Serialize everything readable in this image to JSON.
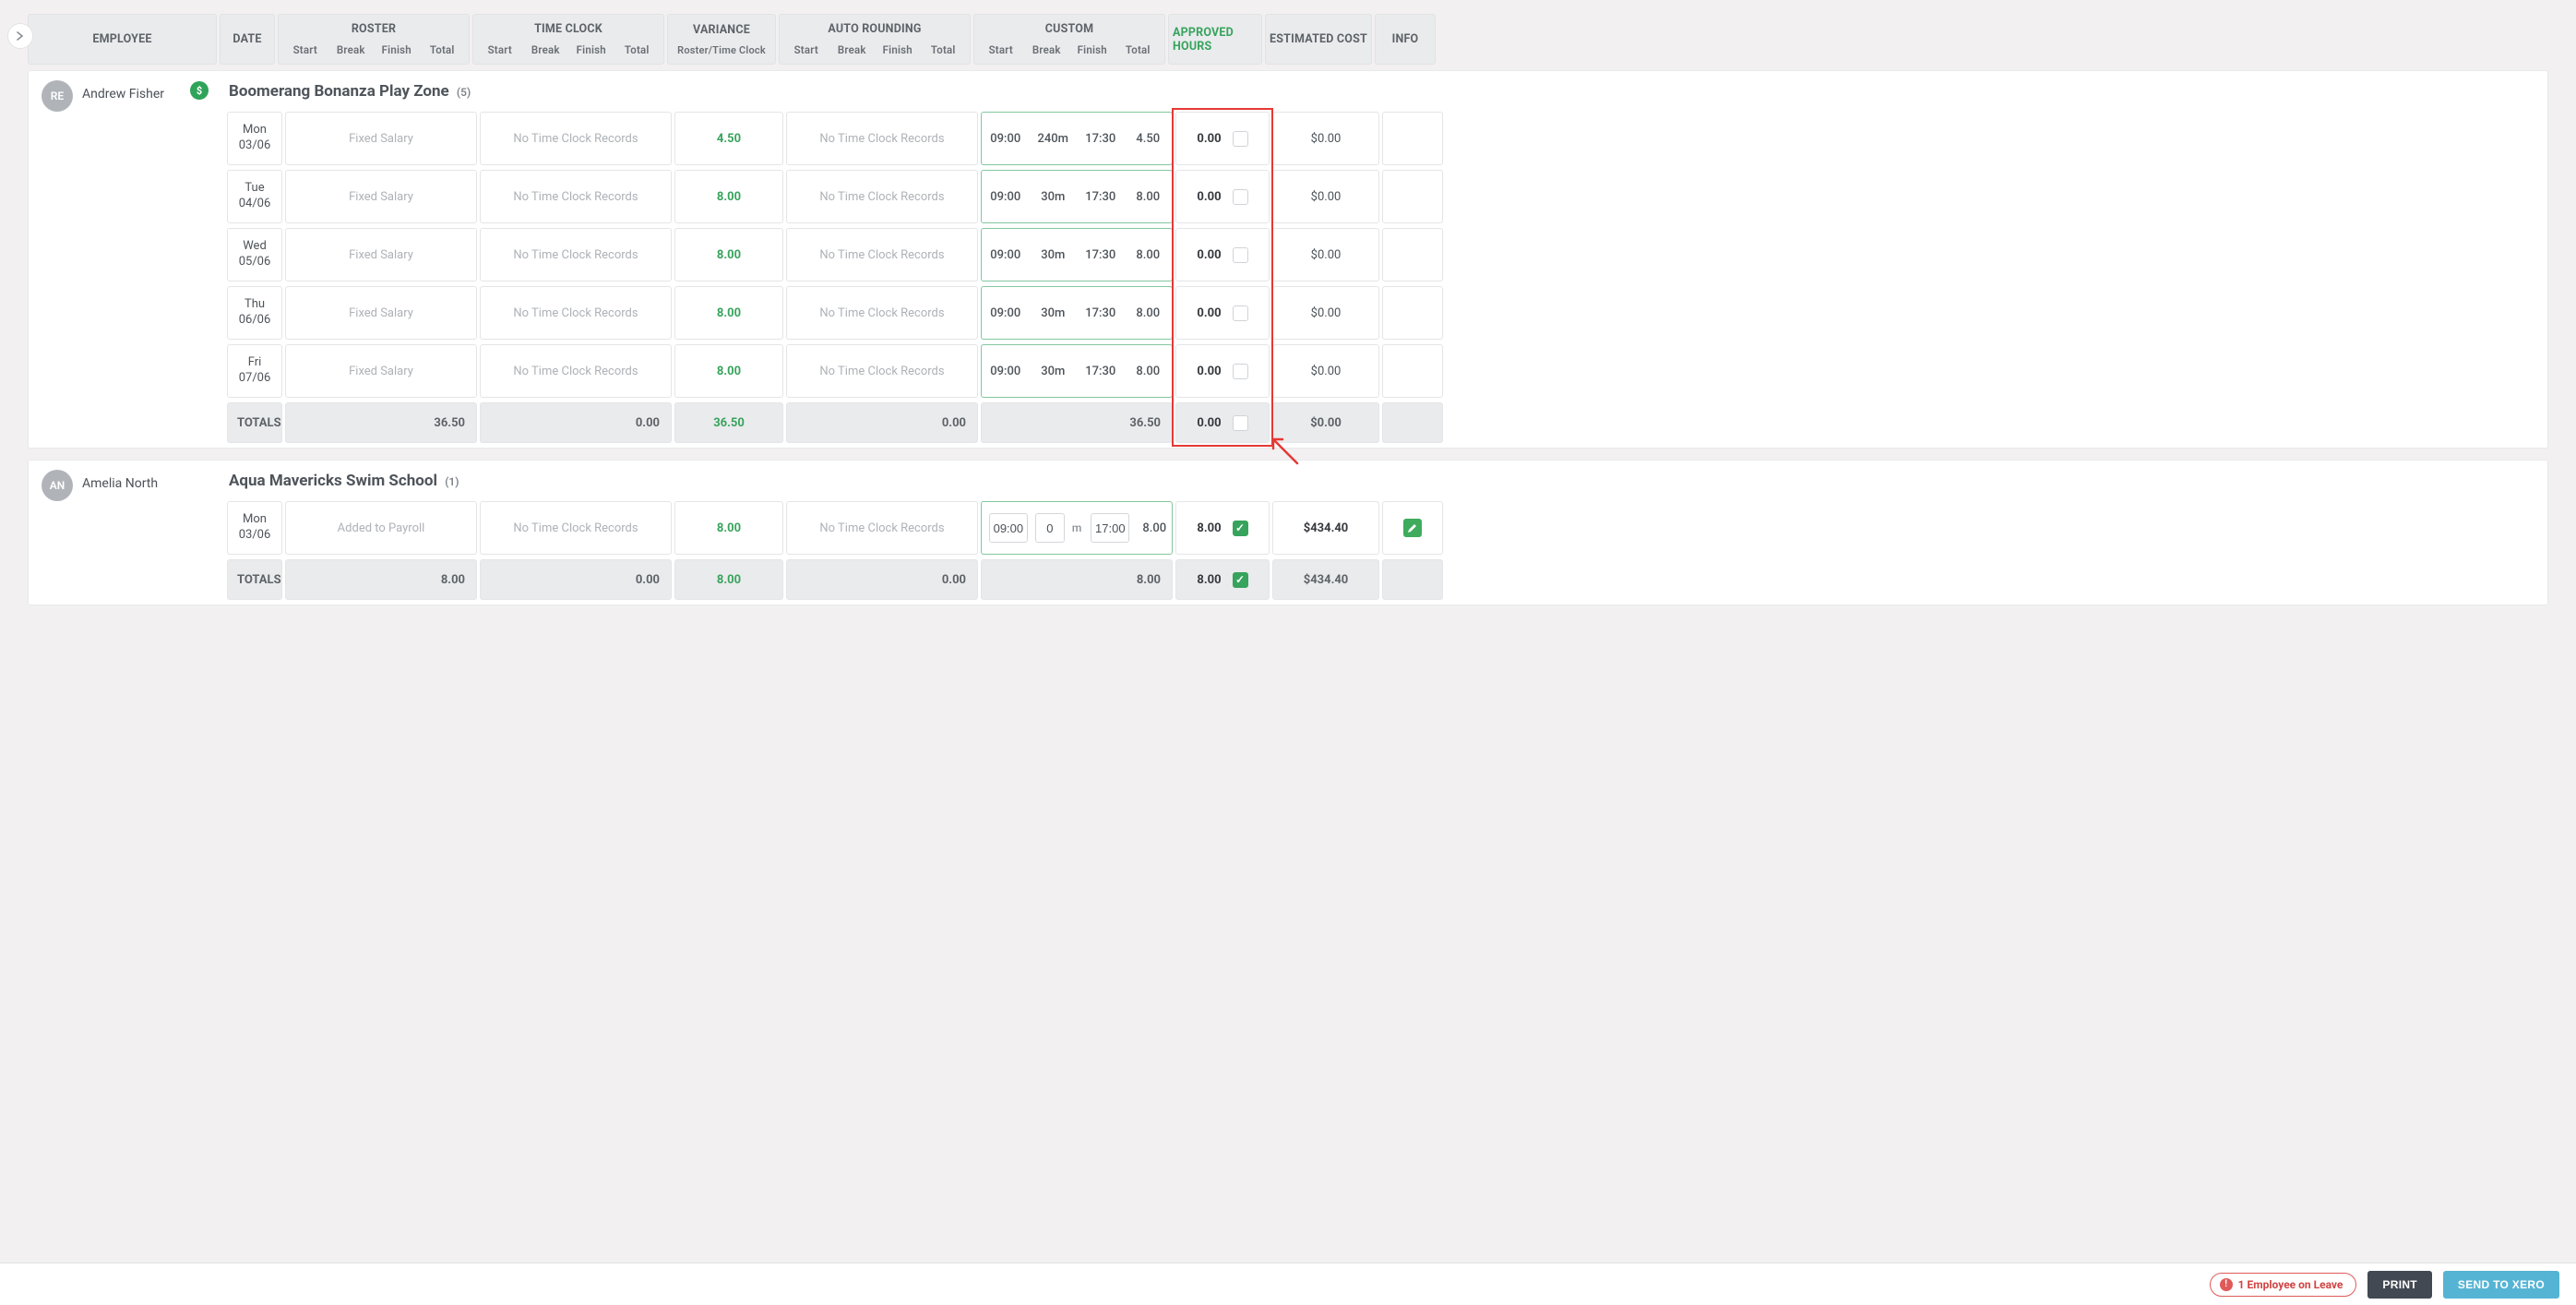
{
  "header": {
    "employee": "EMPLOYEE",
    "date": "DATE",
    "roster": "ROSTER",
    "timeclock": "TIME CLOCK",
    "variance": "VARIANCE",
    "variance_sub": "Roster/Time Clock",
    "autorounding": "AUTO ROUNDING",
    "custom": "CUSTOM",
    "approved": "APPROVED HOURS",
    "cost": "ESTIMATED COST",
    "info": "INFO",
    "subs": {
      "start": "Start",
      "break": "Break",
      "finish": "Finish",
      "total": "Total"
    }
  },
  "employees": [
    {
      "initials": "RE",
      "name": "Andrew Fisher",
      "has_dollar": true,
      "location": "Boomerang Bonanza Play Zone",
      "count": "(5)",
      "rows": [
        {
          "day": "Mon",
          "date": "03/06",
          "roster": "Fixed Salary",
          "tc": "No Time Clock Records",
          "variance": "4.50",
          "auto": "No Time Clock Records",
          "c_start": "09:00",
          "c_break": "240m",
          "c_finish": "17:30",
          "c_total": "4.50",
          "approved": "0.00",
          "checked": false,
          "cost": "$0.00"
        },
        {
          "day": "Tue",
          "date": "04/06",
          "roster": "Fixed Salary",
          "tc": "No Time Clock Records",
          "variance": "8.00",
          "auto": "No Time Clock Records",
          "c_start": "09:00",
          "c_break": "30m",
          "c_finish": "17:30",
          "c_total": "8.00",
          "approved": "0.00",
          "checked": false,
          "cost": "$0.00"
        },
        {
          "day": "Wed",
          "date": "05/06",
          "roster": "Fixed Salary",
          "tc": "No Time Clock Records",
          "variance": "8.00",
          "auto": "No Time Clock Records",
          "c_start": "09:00",
          "c_break": "30m",
          "c_finish": "17:30",
          "c_total": "8.00",
          "approved": "0.00",
          "checked": false,
          "cost": "$0.00"
        },
        {
          "day": "Thu",
          "date": "06/06",
          "roster": "Fixed Salary",
          "tc": "No Time Clock Records",
          "variance": "8.00",
          "auto": "No Time Clock Records",
          "c_start": "09:00",
          "c_break": "30m",
          "c_finish": "17:30",
          "c_total": "8.00",
          "approved": "0.00",
          "checked": false,
          "cost": "$0.00"
        },
        {
          "day": "Fri",
          "date": "07/06",
          "roster": "Fixed Salary",
          "tc": "No Time Clock Records",
          "variance": "8.00",
          "auto": "No Time Clock Records",
          "c_start": "09:00",
          "c_break": "30m",
          "c_finish": "17:30",
          "c_total": "8.00",
          "approved": "0.00",
          "checked": false,
          "cost": "$0.00"
        }
      ],
      "totals": {
        "label": "TOTALS",
        "roster": "36.50",
        "tc": "0.00",
        "variance": "36.50",
        "auto": "0.00",
        "custom": "36.50",
        "approved": "0.00",
        "checked": false,
        "cost": "$0.00"
      }
    },
    {
      "initials": "AN",
      "name": "Amelia North",
      "has_dollar": false,
      "location": "Aqua Mavericks Swim School",
      "count": "(1)",
      "rows": [
        {
          "day": "Mon",
          "date": "03/06",
          "roster": "Added to Payroll",
          "tc": "No Time Clock Records",
          "variance": "8.00",
          "auto": "No Time Clock Records",
          "editable": true,
          "c_start": "09:00",
          "c_break": "0",
          "c_finish": "17:00",
          "c_total": "8.00",
          "approved": "8.00",
          "checked": true,
          "cost": "$434.40",
          "pencil": true
        }
      ],
      "totals": {
        "label": "TOTALS",
        "roster": "8.00",
        "tc": "0.00",
        "variance": "8.00",
        "auto": "0.00",
        "custom": "8.00",
        "approved": "8.00",
        "checked": true,
        "cost": "$434.40"
      }
    }
  ],
  "footer": {
    "alert": "1 Employee on Leave",
    "print": "PRINT",
    "xero": "SEND TO XERO"
  }
}
